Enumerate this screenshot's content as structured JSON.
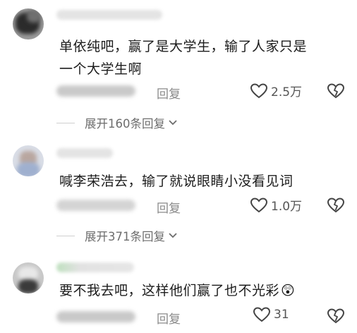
{
  "comments": [
    {
      "text_line1": "单依纯吧，赢了是大学生，输了人家只是",
      "text_line2": "一个大学生啊",
      "reply_label": "回复",
      "likes": "2.5万",
      "expand_label": "展开160条回复"
    },
    {
      "text_line1": "喊李荣浩去，输了就说眼睛小没看见词",
      "reply_label": "回复",
      "likes": "1.0万",
      "expand_label": "展开371条回复"
    },
    {
      "text_line1": "要不我去吧，这样他们赢了也不光彩",
      "emoji": "😲",
      "reply_label": "回复",
      "likes": "31"
    }
  ],
  "icons": {
    "like": "heart-outline-icon",
    "dislike": "broken-heart-icon",
    "expand": "chevron-down-icon"
  },
  "colors": {
    "text": "#1c1c1c",
    "secondary": "#8a8a8a",
    "divider": "#cfcfcf"
  }
}
